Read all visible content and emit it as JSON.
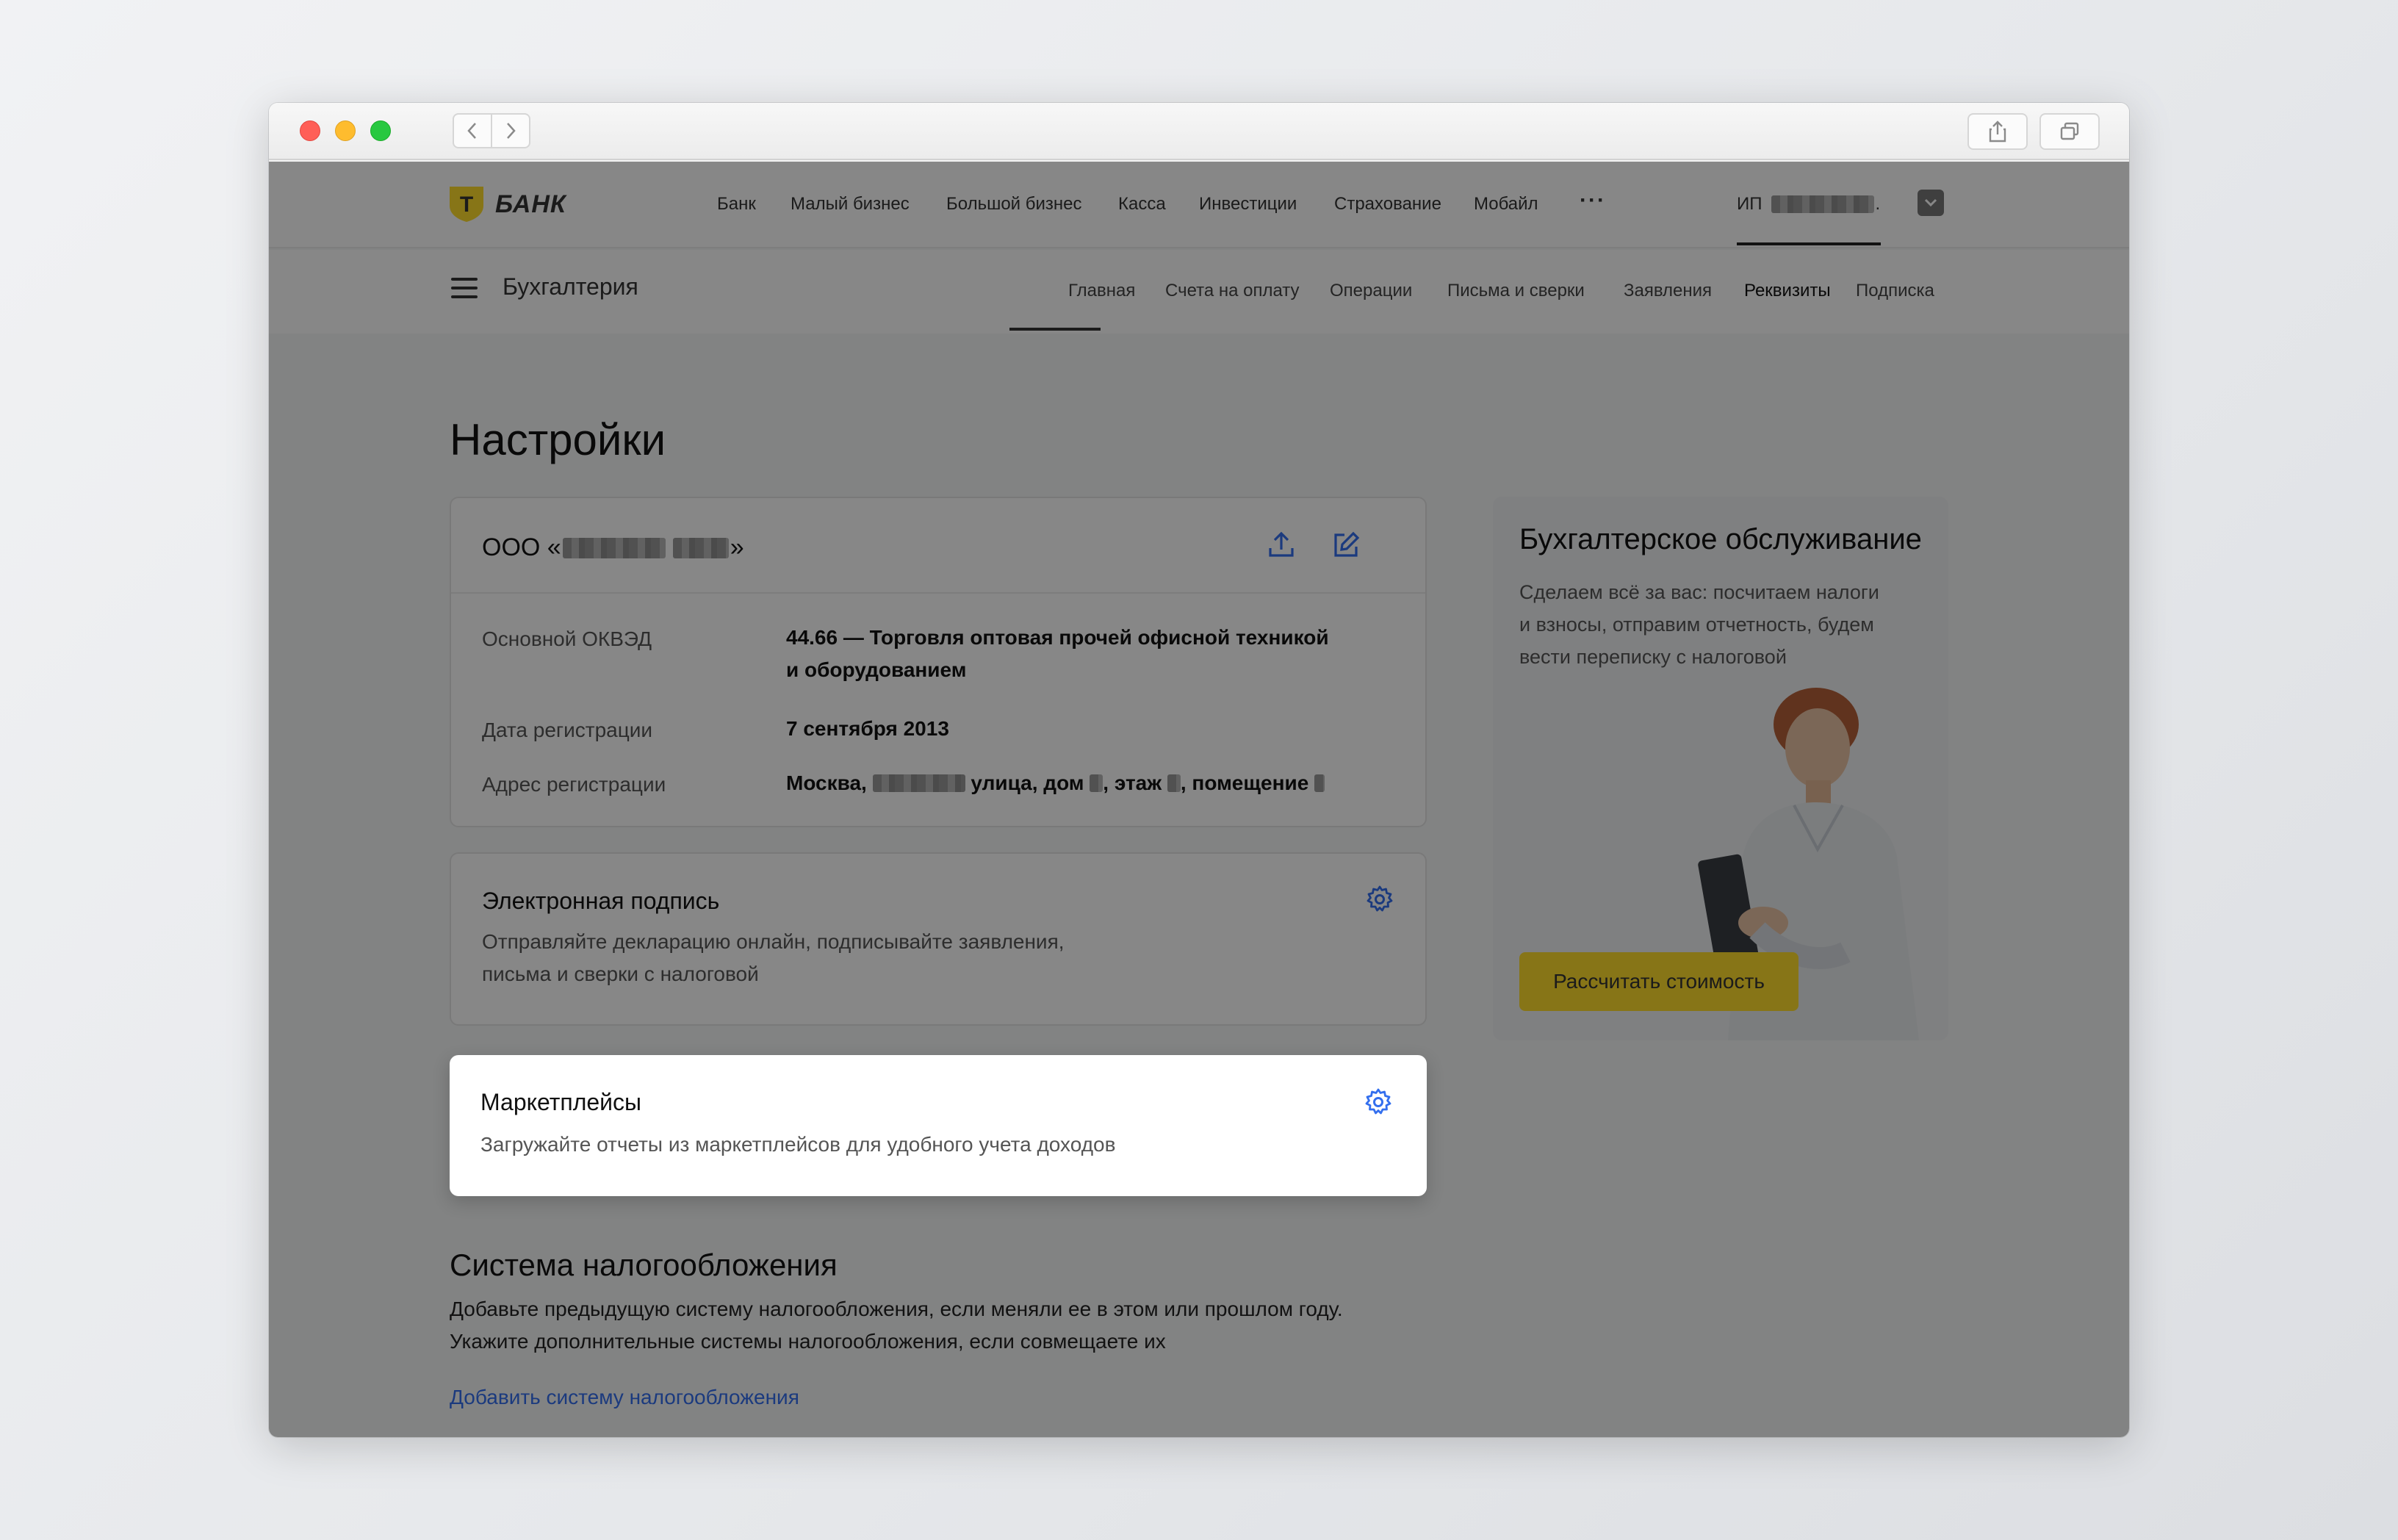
{
  "browser": {
    "window_controls": [
      "close",
      "minimize",
      "maximize"
    ],
    "nav": {
      "back_icon": "chevron-left-icon",
      "forward_icon": "chevron-right-icon"
    },
    "toolbar": {
      "share_icon": "share-icon",
      "tabs_icon": "tabs-icon"
    }
  },
  "topnav": {
    "brand": "БАНК",
    "logo_letter": "Т",
    "items": [
      "Банк",
      "Малый бизнес",
      "Большой бизнес",
      "Касса",
      "Инвестиции",
      "Страхование",
      "Мобайл"
    ],
    "more": "···",
    "user_prefix": "ИП",
    "user_suffix": "."
  },
  "subnav": {
    "title": "Бухгалтерия",
    "tabs": [
      "Главная",
      "Счета на оплату",
      "Операции",
      "Письма и сверки",
      "Заявления",
      "Реквизиты",
      "Подписка"
    ],
    "active_tab": "Реквизиты"
  },
  "main": {
    "title": "Настройки",
    "company": {
      "name_prefix": "ООО «",
      "name_suffix": "»",
      "rows": [
        {
          "label": "Основной ОКВЭД",
          "value_line1": "44.66 — Торговля оптовая прочей офисной техникой",
          "value_line2": "и оборудованием"
        },
        {
          "label": "Дата регистрации",
          "value_line1": "7 сентября 2013"
        },
        {
          "label": "Адрес регистрации",
          "value_parts": [
            "Москва, ",
            " улица, дом ",
            ", этаж ",
            ", помещение "
          ]
        }
      ]
    },
    "esign": {
      "title": "Электронная подпись",
      "desc_line1": "Отправляйте декларацию онлайн, подписывайте заявления,",
      "desc_line2": "письма и сверки с налоговой"
    },
    "marketplaces": {
      "title": "Маркетплейсы",
      "desc": "Загружайте отчеты из маркетплейсов для удобного учета доходов"
    },
    "tax": {
      "title": "Система налогообложения",
      "desc_line1": "Добавьте предыдущую систему налогообложения, если меняли ее в этом или прошлом году.",
      "desc_line2": "Укажите дополнительные системы налогообложения, если совмещаете их",
      "link": "Добавить систему налогообложения"
    }
  },
  "promo": {
    "title": "Бухгалтерское обслуживание",
    "desc_line1": "Сделаем всё за вас: посчитаем налоги",
    "desc_line2": "и взносы, отправим отчетность, будем",
    "desc_line3": "вести переписку с налоговой",
    "button": "Рассчитать стоимость"
  },
  "colors": {
    "accent": "#336fee",
    "brand_yellow": "#ffdd2d",
    "overlay": "rgba(0,0,0,0.47)",
    "text": "#111111"
  }
}
